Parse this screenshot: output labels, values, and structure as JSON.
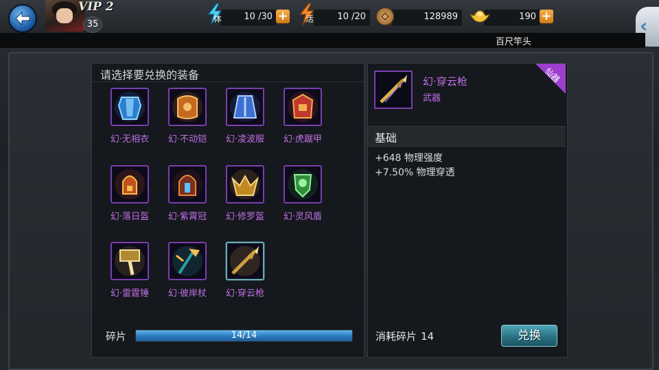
{
  "header": {
    "vip": "VIP 2",
    "level": "35",
    "resources": [
      {
        "icon": "stamina-lightning-icon",
        "badge": "体",
        "value": "10 /30"
      },
      {
        "icon": "energy-lightning-icon",
        "badge": "活",
        "value": "10 /20"
      },
      {
        "icon": "copper-coin-icon",
        "value": "128989"
      },
      {
        "icon": "gold-ingot-icon",
        "value": "190"
      }
    ],
    "location": "百尺竿头"
  },
  "left_panel": {
    "title": "请选择要兑换的装备",
    "items": [
      {
        "label": "幻·无相衣",
        "icon": "armor-robe-icon"
      },
      {
        "label": "幻·不动铠",
        "icon": "heavy-armor-icon"
      },
      {
        "label": "幻·凌波服",
        "icon": "light-armor-icon"
      },
      {
        "label": "幻·虎踞甲",
        "icon": "tiger-armor-icon"
      },
      {
        "label": "幻·落日盔",
        "icon": "sunset-helmet-icon"
      },
      {
        "label": "幻·紫霄冠",
        "icon": "crown-helmet-icon"
      },
      {
        "label": "幻·修罗盔",
        "icon": "demon-helmet-icon"
      },
      {
        "label": "幻·灵风盾",
        "icon": "spirit-shield-icon"
      },
      {
        "label": "幻·雷霆锤",
        "icon": "thunder-hammer-icon"
      },
      {
        "label": "幻·彼岸杖",
        "icon": "staff-icon"
      },
      {
        "label": "幻·穿云枪",
        "icon": "spear-icon",
        "selected": true
      }
    ],
    "fragments": {
      "label": "碎片",
      "text": "14/14",
      "progress": 1.0
    }
  },
  "right_panel": {
    "name": "幻·穿云枪",
    "type": "武器",
    "rarity": "仙器",
    "section_title": "基础",
    "stats": [
      "+648 物理强度",
      "+7.50% 物理穿透"
    ],
    "cost_label": "消耗碎片",
    "cost_value": "14",
    "exchange_label": "兑换"
  },
  "colors": {
    "rarity_purple": "#c070e6",
    "slot_border": "#7a3fb0",
    "progress_blue": "#2a79bd",
    "button_teal": "#2a7283"
  }
}
